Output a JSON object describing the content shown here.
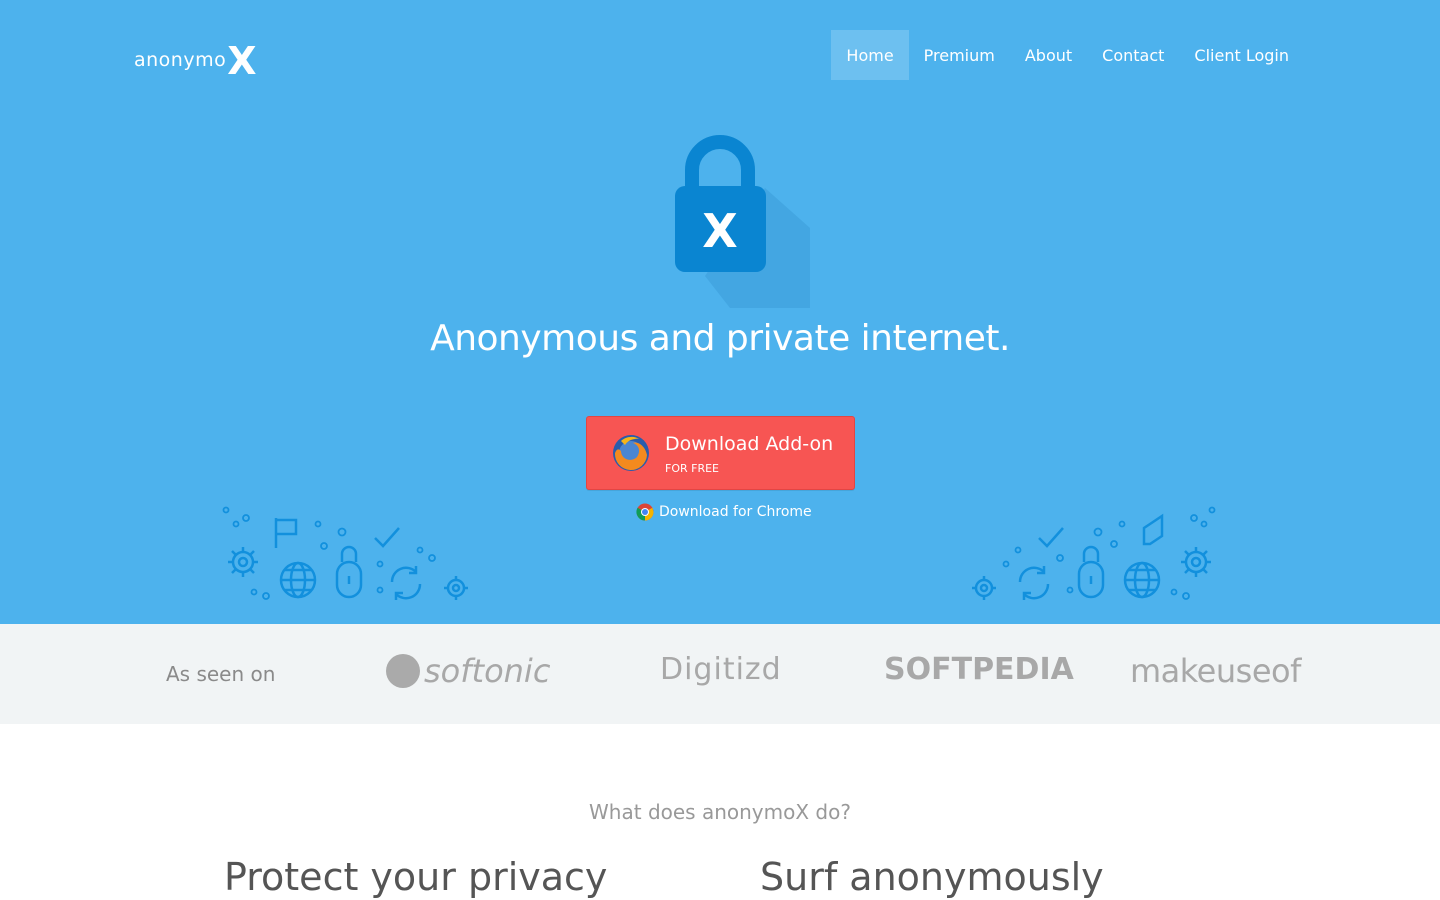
{
  "brand": {
    "name_prefix": "anonymo",
    "name_suffix": "X"
  },
  "nav": {
    "items": [
      {
        "label": "Home",
        "active": true
      },
      {
        "label": "Premium",
        "active": false
      },
      {
        "label": "About",
        "active": false
      },
      {
        "label": "Contact",
        "active": false
      },
      {
        "label": "Client Login",
        "active": false
      }
    ]
  },
  "hero": {
    "lock_letter": "X",
    "headline": "Anonymous and private internet.",
    "download_button": {
      "label": "Download Add-on",
      "sublabel": "FOR FREE",
      "icon": "firefox-icon"
    },
    "chrome_link": {
      "label": "Download for Chrome",
      "icon": "chrome-icon"
    }
  },
  "press": {
    "label": "As seen on",
    "logos": [
      "softonic",
      "Digitizd",
      "SOFTPEDIA",
      "makeuseof"
    ]
  },
  "features": {
    "heading": "What does anonymoX do?",
    "items": [
      "Protect your privacy",
      "Surf anonymously"
    ]
  },
  "colors": {
    "hero_bg": "#4db2ed",
    "lock": "#0a85d1",
    "button": "#f75553",
    "press_bg": "#f1f4f5",
    "deco_icons": "#1290dd"
  }
}
